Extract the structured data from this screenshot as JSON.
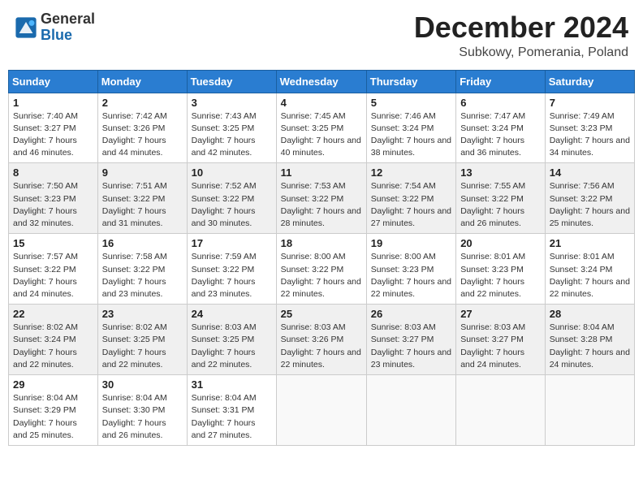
{
  "header": {
    "logo_line1": "General",
    "logo_line2": "Blue",
    "month_title": "December 2024",
    "subtitle": "Subkowy, Pomerania, Poland"
  },
  "weekdays": [
    "Sunday",
    "Monday",
    "Tuesday",
    "Wednesday",
    "Thursday",
    "Friday",
    "Saturday"
  ],
  "weeks": [
    [
      {
        "day": "1",
        "sunrise": "Sunrise: 7:40 AM",
        "sunset": "Sunset: 3:27 PM",
        "daylight": "Daylight: 7 hours and 46 minutes."
      },
      {
        "day": "2",
        "sunrise": "Sunrise: 7:42 AM",
        "sunset": "Sunset: 3:26 PM",
        "daylight": "Daylight: 7 hours and 44 minutes."
      },
      {
        "day": "3",
        "sunrise": "Sunrise: 7:43 AM",
        "sunset": "Sunset: 3:25 PM",
        "daylight": "Daylight: 7 hours and 42 minutes."
      },
      {
        "day": "4",
        "sunrise": "Sunrise: 7:45 AM",
        "sunset": "Sunset: 3:25 PM",
        "daylight": "Daylight: 7 hours and 40 minutes."
      },
      {
        "day": "5",
        "sunrise": "Sunrise: 7:46 AM",
        "sunset": "Sunset: 3:24 PM",
        "daylight": "Daylight: 7 hours and 38 minutes."
      },
      {
        "day": "6",
        "sunrise": "Sunrise: 7:47 AM",
        "sunset": "Sunset: 3:24 PM",
        "daylight": "Daylight: 7 hours and 36 minutes."
      },
      {
        "day": "7",
        "sunrise": "Sunrise: 7:49 AM",
        "sunset": "Sunset: 3:23 PM",
        "daylight": "Daylight: 7 hours and 34 minutes."
      }
    ],
    [
      {
        "day": "8",
        "sunrise": "Sunrise: 7:50 AM",
        "sunset": "Sunset: 3:23 PM",
        "daylight": "Daylight: 7 hours and 32 minutes."
      },
      {
        "day": "9",
        "sunrise": "Sunrise: 7:51 AM",
        "sunset": "Sunset: 3:22 PM",
        "daylight": "Daylight: 7 hours and 31 minutes."
      },
      {
        "day": "10",
        "sunrise": "Sunrise: 7:52 AM",
        "sunset": "Sunset: 3:22 PM",
        "daylight": "Daylight: 7 hours and 30 minutes."
      },
      {
        "day": "11",
        "sunrise": "Sunrise: 7:53 AM",
        "sunset": "Sunset: 3:22 PM",
        "daylight": "Daylight: 7 hours and 28 minutes."
      },
      {
        "day": "12",
        "sunrise": "Sunrise: 7:54 AM",
        "sunset": "Sunset: 3:22 PM",
        "daylight": "Daylight: 7 hours and 27 minutes."
      },
      {
        "day": "13",
        "sunrise": "Sunrise: 7:55 AM",
        "sunset": "Sunset: 3:22 PM",
        "daylight": "Daylight: 7 hours and 26 minutes."
      },
      {
        "day": "14",
        "sunrise": "Sunrise: 7:56 AM",
        "sunset": "Sunset: 3:22 PM",
        "daylight": "Daylight: 7 hours and 25 minutes."
      }
    ],
    [
      {
        "day": "15",
        "sunrise": "Sunrise: 7:57 AM",
        "sunset": "Sunset: 3:22 PM",
        "daylight": "Daylight: 7 hours and 24 minutes."
      },
      {
        "day": "16",
        "sunrise": "Sunrise: 7:58 AM",
        "sunset": "Sunset: 3:22 PM",
        "daylight": "Daylight: 7 hours and 23 minutes."
      },
      {
        "day": "17",
        "sunrise": "Sunrise: 7:59 AM",
        "sunset": "Sunset: 3:22 PM",
        "daylight": "Daylight: 7 hours and 23 minutes."
      },
      {
        "day": "18",
        "sunrise": "Sunrise: 8:00 AM",
        "sunset": "Sunset: 3:22 PM",
        "daylight": "Daylight: 7 hours and 22 minutes."
      },
      {
        "day": "19",
        "sunrise": "Sunrise: 8:00 AM",
        "sunset": "Sunset: 3:23 PM",
        "daylight": "Daylight: 7 hours and 22 minutes."
      },
      {
        "day": "20",
        "sunrise": "Sunrise: 8:01 AM",
        "sunset": "Sunset: 3:23 PM",
        "daylight": "Daylight: 7 hours and 22 minutes."
      },
      {
        "day": "21",
        "sunrise": "Sunrise: 8:01 AM",
        "sunset": "Sunset: 3:24 PM",
        "daylight": "Daylight: 7 hours and 22 minutes."
      }
    ],
    [
      {
        "day": "22",
        "sunrise": "Sunrise: 8:02 AM",
        "sunset": "Sunset: 3:24 PM",
        "daylight": "Daylight: 7 hours and 22 minutes."
      },
      {
        "day": "23",
        "sunrise": "Sunrise: 8:02 AM",
        "sunset": "Sunset: 3:25 PM",
        "daylight": "Daylight: 7 hours and 22 minutes."
      },
      {
        "day": "24",
        "sunrise": "Sunrise: 8:03 AM",
        "sunset": "Sunset: 3:25 PM",
        "daylight": "Daylight: 7 hours and 22 minutes."
      },
      {
        "day": "25",
        "sunrise": "Sunrise: 8:03 AM",
        "sunset": "Sunset: 3:26 PM",
        "daylight": "Daylight: 7 hours and 22 minutes."
      },
      {
        "day": "26",
        "sunrise": "Sunrise: 8:03 AM",
        "sunset": "Sunset: 3:27 PM",
        "daylight": "Daylight: 7 hours and 23 minutes."
      },
      {
        "day": "27",
        "sunrise": "Sunrise: 8:03 AM",
        "sunset": "Sunset: 3:27 PM",
        "daylight": "Daylight: 7 hours and 24 minutes."
      },
      {
        "day": "28",
        "sunrise": "Sunrise: 8:04 AM",
        "sunset": "Sunset: 3:28 PM",
        "daylight": "Daylight: 7 hours and 24 minutes."
      }
    ],
    [
      {
        "day": "29",
        "sunrise": "Sunrise: 8:04 AM",
        "sunset": "Sunset: 3:29 PM",
        "daylight": "Daylight: 7 hours and 25 minutes."
      },
      {
        "day": "30",
        "sunrise": "Sunrise: 8:04 AM",
        "sunset": "Sunset: 3:30 PM",
        "daylight": "Daylight: 7 hours and 26 minutes."
      },
      {
        "day": "31",
        "sunrise": "Sunrise: 8:04 AM",
        "sunset": "Sunset: 3:31 PM",
        "daylight": "Daylight: 7 hours and 27 minutes."
      },
      null,
      null,
      null,
      null
    ]
  ]
}
